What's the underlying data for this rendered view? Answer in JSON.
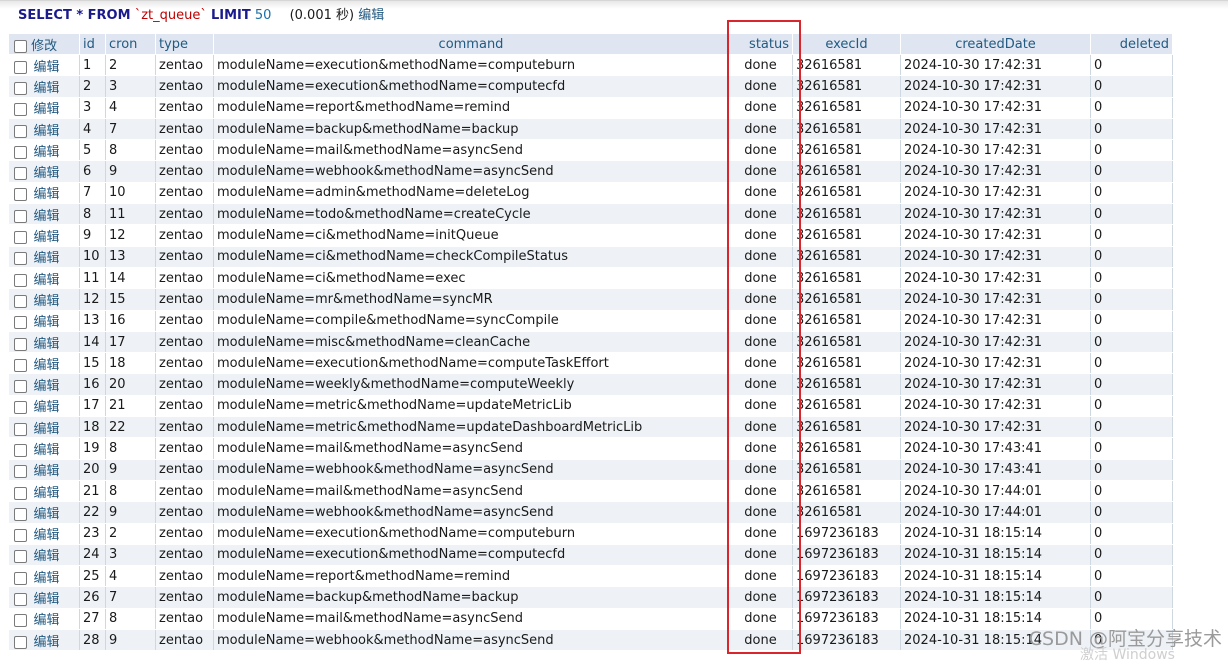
{
  "query": {
    "select": "SELECT * FROM",
    "table": "`zt_queue`",
    "limit_kw": "LIMIT",
    "limit_val": "50",
    "timing": "(0.001 秒)",
    "edit_link": "编辑"
  },
  "columns": [
    "修改",
    "id",
    "cron",
    "type",
    "command",
    "status",
    "execId",
    "createdDate",
    "deleted"
  ],
  "edit_label": "编辑",
  "rows": [
    [
      "1",
      "2",
      "zentao",
      "moduleName=execution&methodName=computeburn",
      "done",
      "32616581",
      "2024-10-30 17:42:31",
      "0"
    ],
    [
      "2",
      "3",
      "zentao",
      "moduleName=execution&methodName=computecfd",
      "done",
      "32616581",
      "2024-10-30 17:42:31",
      "0"
    ],
    [
      "3",
      "4",
      "zentao",
      "moduleName=report&methodName=remind",
      "done",
      "32616581",
      "2024-10-30 17:42:31",
      "0"
    ],
    [
      "4",
      "7",
      "zentao",
      "moduleName=backup&methodName=backup",
      "done",
      "32616581",
      "2024-10-30 17:42:31",
      "0"
    ],
    [
      "5",
      "8",
      "zentao",
      "moduleName=mail&methodName=asyncSend",
      "done",
      "32616581",
      "2024-10-30 17:42:31",
      "0"
    ],
    [
      "6",
      "9",
      "zentao",
      "moduleName=webhook&methodName=asyncSend",
      "done",
      "32616581",
      "2024-10-30 17:42:31",
      "0"
    ],
    [
      "7",
      "10",
      "zentao",
      "moduleName=admin&methodName=deleteLog",
      "done",
      "32616581",
      "2024-10-30 17:42:31",
      "0"
    ],
    [
      "8",
      "11",
      "zentao",
      "moduleName=todo&methodName=createCycle",
      "done",
      "32616581",
      "2024-10-30 17:42:31",
      "0"
    ],
    [
      "9",
      "12",
      "zentao",
      "moduleName=ci&methodName=initQueue",
      "done",
      "32616581",
      "2024-10-30 17:42:31",
      "0"
    ],
    [
      "10",
      "13",
      "zentao",
      "moduleName=ci&methodName=checkCompileStatus",
      "done",
      "32616581",
      "2024-10-30 17:42:31",
      "0"
    ],
    [
      "11",
      "14",
      "zentao",
      "moduleName=ci&methodName=exec",
      "done",
      "32616581",
      "2024-10-30 17:42:31",
      "0"
    ],
    [
      "12",
      "15",
      "zentao",
      "moduleName=mr&methodName=syncMR",
      "done",
      "32616581",
      "2024-10-30 17:42:31",
      "0"
    ],
    [
      "13",
      "16",
      "zentao",
      "moduleName=compile&methodName=syncCompile",
      "done",
      "32616581",
      "2024-10-30 17:42:31",
      "0"
    ],
    [
      "14",
      "17",
      "zentao",
      "moduleName=misc&methodName=cleanCache",
      "done",
      "32616581",
      "2024-10-30 17:42:31",
      "0"
    ],
    [
      "15",
      "18",
      "zentao",
      "moduleName=execution&methodName=computeTaskEffort",
      "done",
      "32616581",
      "2024-10-30 17:42:31",
      "0"
    ],
    [
      "16",
      "20",
      "zentao",
      "moduleName=weekly&methodName=computeWeekly",
      "done",
      "32616581",
      "2024-10-30 17:42:31",
      "0"
    ],
    [
      "17",
      "21",
      "zentao",
      "moduleName=metric&methodName=updateMetricLib",
      "done",
      "32616581",
      "2024-10-30 17:42:31",
      "0"
    ],
    [
      "18",
      "22",
      "zentao",
      "moduleName=metric&methodName=updateDashboardMetricLib",
      "done",
      "32616581",
      "2024-10-30 17:42:31",
      "0"
    ],
    [
      "19",
      "8",
      "zentao",
      "moduleName=mail&methodName=asyncSend",
      "done",
      "32616581",
      "2024-10-30 17:43:41",
      "0"
    ],
    [
      "20",
      "9",
      "zentao",
      "moduleName=webhook&methodName=asyncSend",
      "done",
      "32616581",
      "2024-10-30 17:43:41",
      "0"
    ],
    [
      "21",
      "8",
      "zentao",
      "moduleName=mail&methodName=asyncSend",
      "done",
      "32616581",
      "2024-10-30 17:44:01",
      "0"
    ],
    [
      "22",
      "9",
      "zentao",
      "moduleName=webhook&methodName=asyncSend",
      "done",
      "32616581",
      "2024-10-30 17:44:01",
      "0"
    ],
    [
      "23",
      "2",
      "zentao",
      "moduleName=execution&methodName=computeburn",
      "done",
      "1697236183",
      "2024-10-31 18:15:14",
      "0"
    ],
    [
      "24",
      "3",
      "zentao",
      "moduleName=execution&methodName=computecfd",
      "done",
      "1697236183",
      "2024-10-31 18:15:14",
      "0"
    ],
    [
      "25",
      "4",
      "zentao",
      "moduleName=report&methodName=remind",
      "done",
      "1697236183",
      "2024-10-31 18:15:14",
      "0"
    ],
    [
      "26",
      "7",
      "zentao",
      "moduleName=backup&methodName=backup",
      "done",
      "1697236183",
      "2024-10-31 18:15:14",
      "0"
    ],
    [
      "27",
      "8",
      "zentao",
      "moduleName=mail&methodName=asyncSend",
      "done",
      "1697236183",
      "2024-10-31 18:15:14",
      "0"
    ],
    [
      "28",
      "9",
      "zentao",
      "moduleName=webhook&methodName=asyncSend",
      "done",
      "1697236183",
      "2024-10-31 18:15:14",
      "0"
    ]
  ],
  "watermark": "CSDN @阿宝分享技术",
  "faint_text": "激活 Windows",
  "colors": {
    "highlight_box": "#d9262c",
    "header_bg": "#dfe6f1",
    "link": "#235a81",
    "row_alt": "#eef2f7"
  }
}
